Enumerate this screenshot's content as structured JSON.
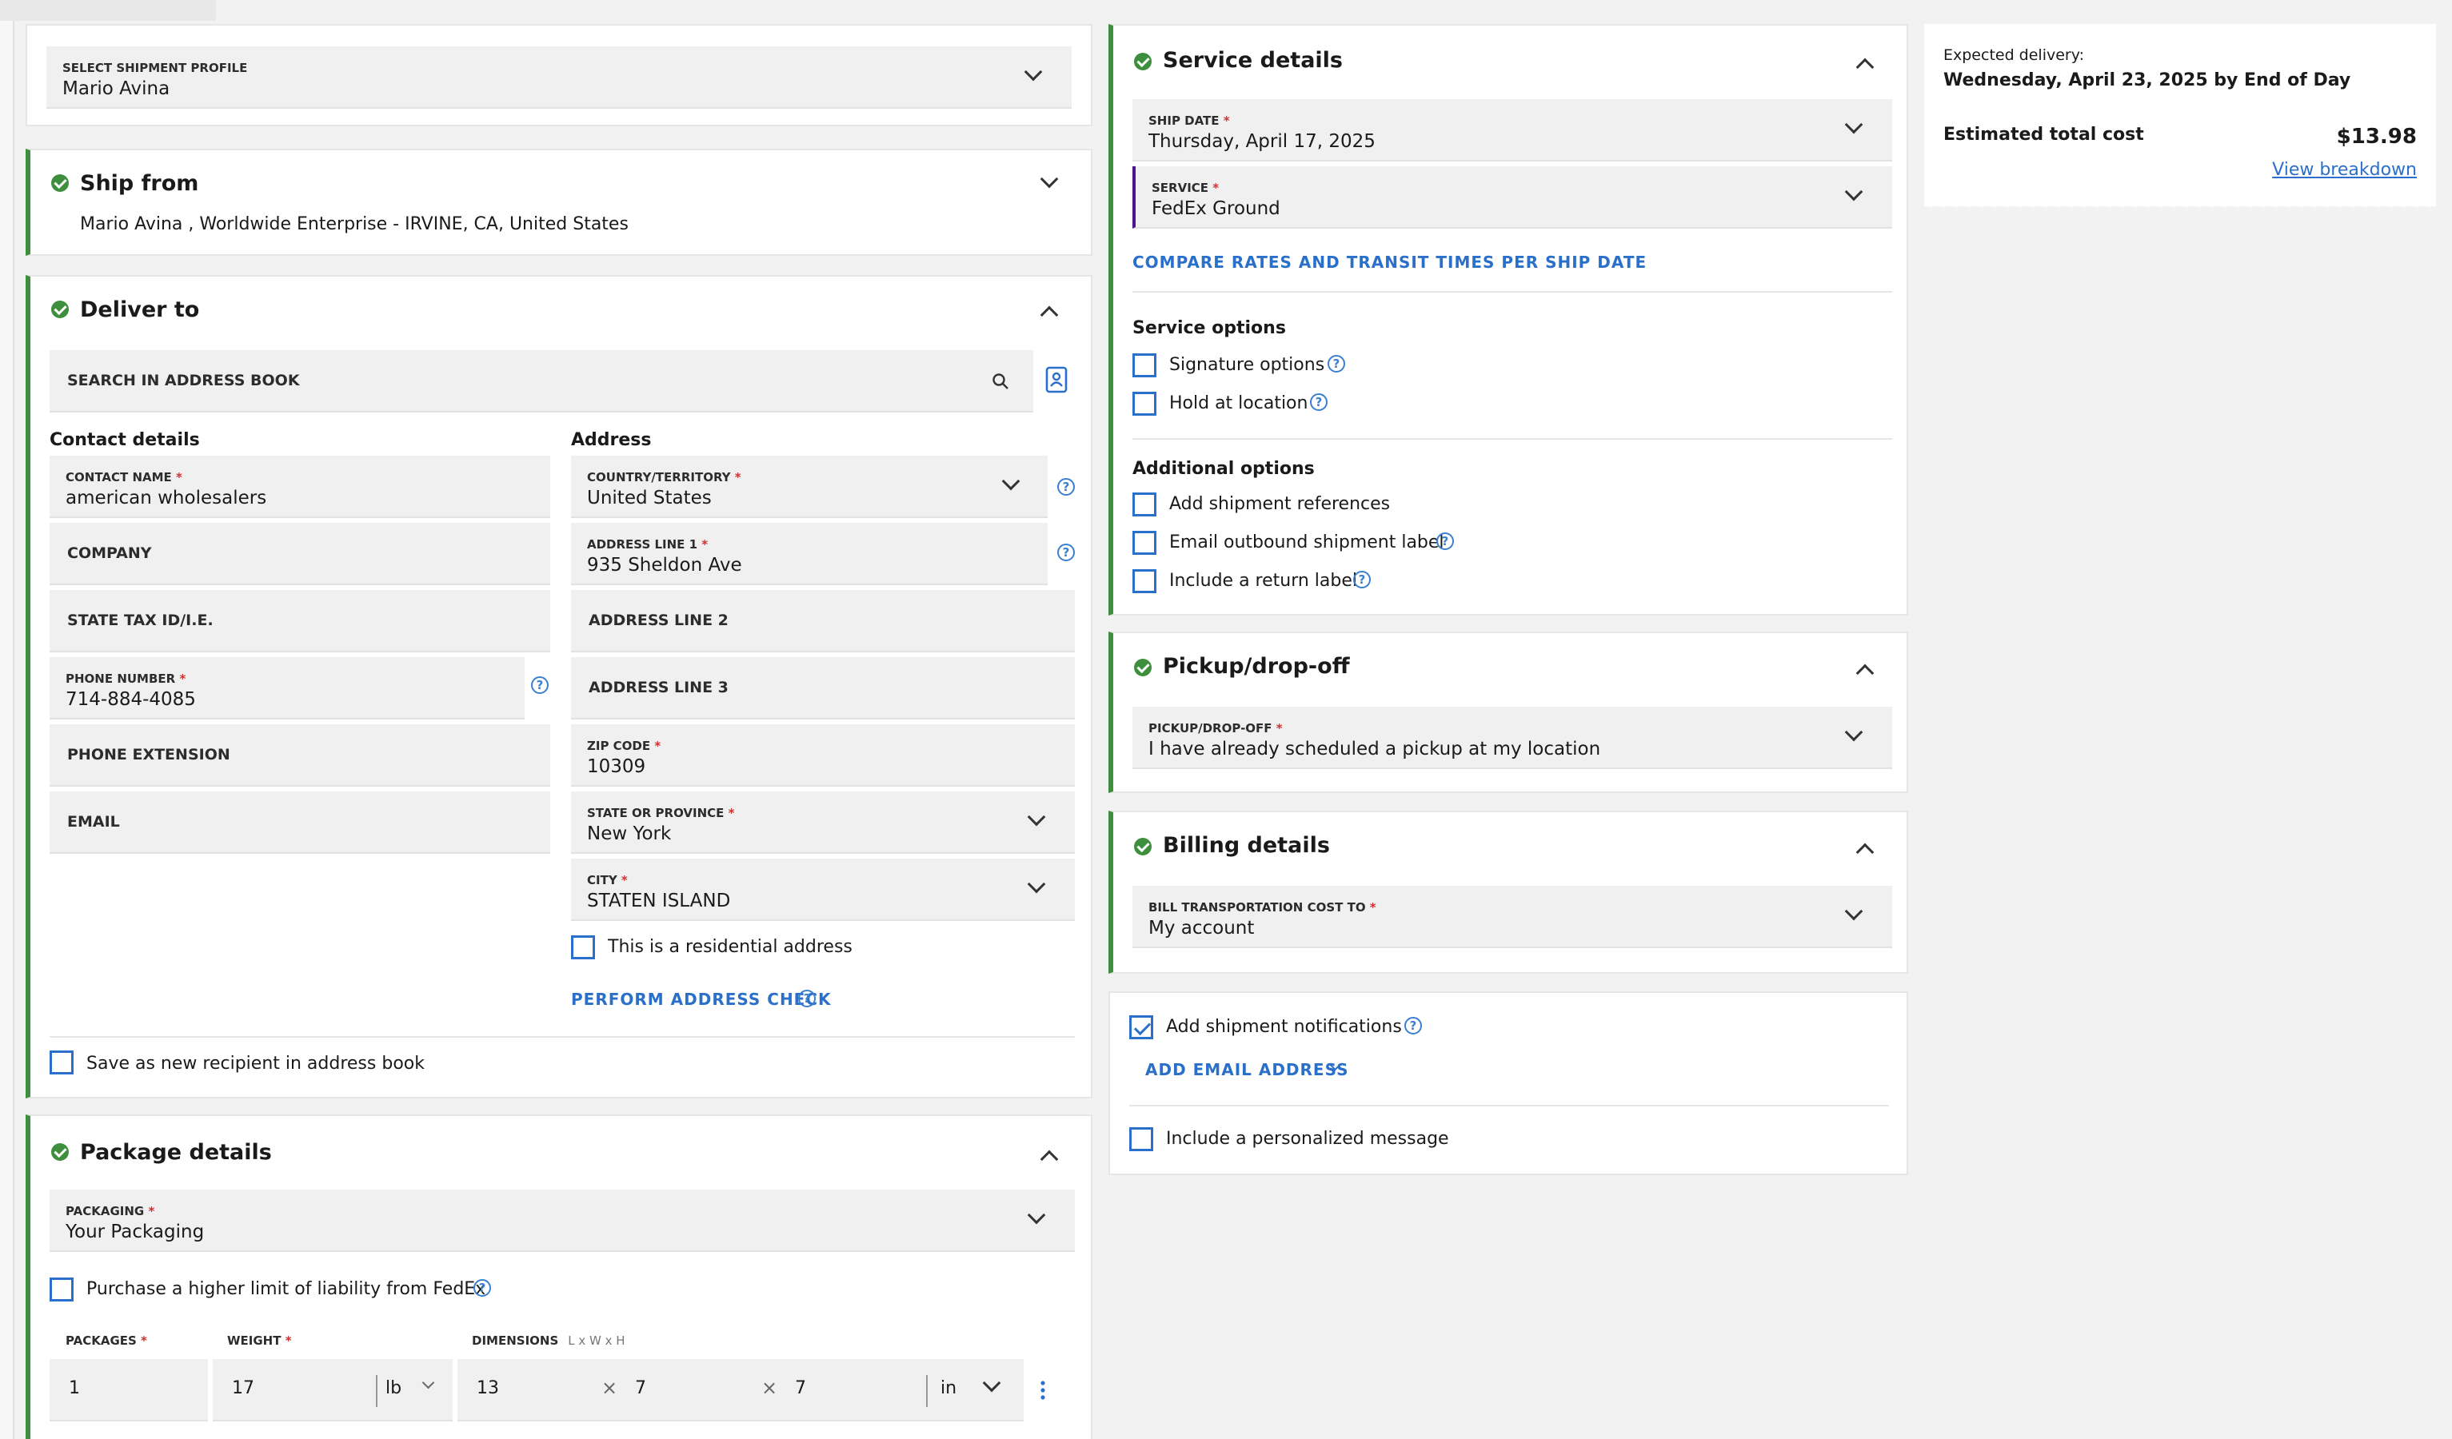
{
  "profile": {
    "label": "SELECT SHIPMENT PROFILE",
    "value": "Mario Avina"
  },
  "ship_from": {
    "title": "Ship from",
    "summary": "Mario Avina , Worldwide Enterprise - IRVINE, CA, United States"
  },
  "deliver_to": {
    "title": "Deliver to",
    "search_placeholder": "SEARCH IN ADDRESS BOOK",
    "contact_heading": "Contact details",
    "address_heading": "Address",
    "contact_name": {
      "label": "CONTACT NAME",
      "value": "american wholesalers"
    },
    "company_placeholder": "COMPANY",
    "state_tax_placeholder": "STATE TAX ID/I.E.",
    "phone": {
      "label": "PHONE NUMBER",
      "value": "714-884-4085"
    },
    "phone_ext_placeholder": "PHONE EXTENSION",
    "email_placeholder": "EMAIL",
    "country": {
      "label": "COUNTRY/TERRITORY",
      "value": "United States"
    },
    "address1": {
      "label": "ADDRESS LINE 1",
      "value": "935 Sheldon Ave"
    },
    "address2_placeholder": "ADDRESS LINE 2",
    "address3_placeholder": "ADDRESS LINE 3",
    "zip": {
      "label": "ZIP CODE",
      "value": "10309"
    },
    "state": {
      "label": "STATE OR PROVINCE",
      "value": "New York"
    },
    "city": {
      "label": "CITY",
      "value": "STATEN ISLAND"
    },
    "residential_label": "This is a residential address",
    "address_check_link": "PERFORM ADDRESS CHECK",
    "save_recipient_label": "Save as new recipient in address book"
  },
  "package": {
    "title": "Package details",
    "packaging": {
      "label": "PACKAGING",
      "value": "Your Packaging"
    },
    "liability_label": "Purchase a higher limit of liability from FedEx",
    "packages_label": "PACKAGES",
    "weight_label": "WEIGHT",
    "dimensions_label": "DIMENSIONS",
    "dimensions_hint": "L x W x H",
    "packages_value": "1",
    "weight_value": "17",
    "weight_unit": "lb",
    "length": "13",
    "width": "7",
    "height": "7",
    "dim_unit": "in"
  },
  "service": {
    "title": "Service details",
    "ship_date": {
      "label": "SHIP DATE",
      "value": "Thursday, April 17, 2025"
    },
    "service": {
      "label": "SERVICE",
      "value": "FedEx Ground"
    },
    "compare_link": "COMPARE RATES AND TRANSIT TIMES PER SHIP DATE",
    "options_heading": "Service options",
    "signature_label": "Signature options",
    "hold_label": "Hold at location",
    "additional_heading": "Additional options",
    "references_label": "Add shipment references",
    "email_label_label": "Email outbound shipment label",
    "return_label": "Include a return label"
  },
  "pickup": {
    "title": "Pickup/drop-off",
    "field": {
      "label": "PICKUP/DROP-OFF",
      "value": "I have already scheduled a pickup at my location"
    }
  },
  "billing": {
    "title": "Billing details",
    "field": {
      "label": "BILL TRANSPORTATION COST TO",
      "value": "My account"
    }
  },
  "notifications": {
    "add_label": "Add shipment notifications",
    "add_email_link": "ADD EMAIL ADDRESS",
    "personalized_label": "Include a personalized message"
  },
  "summary": {
    "expected_label": "Expected delivery:",
    "expected_value": "Wednesday, April 23, 2025 by End of Day",
    "cost_label": "Estimated total cost",
    "cost_value": "$13.98",
    "breakdown_link": "View breakdown"
  },
  "colors": {
    "success": "#3d8f3d",
    "link": "#2a6fc9",
    "required": "#d32f2f",
    "field_bg": "#f0f0f0"
  }
}
